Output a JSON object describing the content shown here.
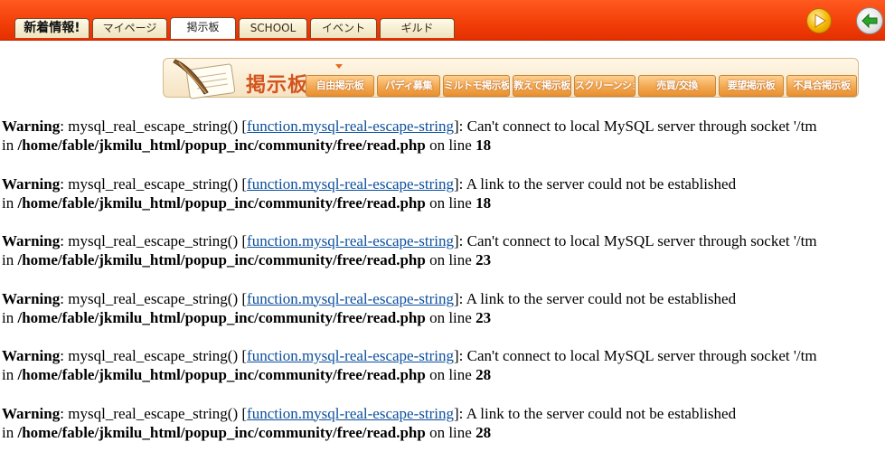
{
  "nav": {
    "tabs": [
      {
        "label": "新着情報!"
      },
      {
        "label": "マイページ"
      },
      {
        "label": "掲示板"
      },
      {
        "label": "SCHOOL"
      },
      {
        "label": "イベント"
      },
      {
        "label": "ギルド"
      }
    ],
    "active_tab": "掲示板"
  },
  "icons": {
    "play": "play-icon",
    "back": "back-arrow-icon",
    "quill": "quill-scroll-icon"
  },
  "board": {
    "title": "掲示板",
    "subtabs": [
      {
        "label": "自由掲示板"
      },
      {
        "label": "パディ募集"
      },
      {
        "label": "ミルトモ掲示板"
      },
      {
        "label": "教えて掲示板"
      },
      {
        "label": "スクリーンショット"
      },
      {
        "label": "売買/交換"
      },
      {
        "label": "要望掲示板"
      },
      {
        "label": "不具合掲示板"
      }
    ]
  },
  "colors": {
    "topbar": "#f23d08",
    "link": "#0b4f9e",
    "subtab": "#f2a852",
    "title": "#d3551e"
  },
  "warnings": [
    {
      "label": "Warning",
      "func": "mysql_real_escape_string()",
      "link": "function.mysql-real-escape-string",
      "message": "Can't connect to local MySQL server through socket '/tm",
      "in": "in",
      "path": "/home/fable/jkmilu_html/popup_inc/community/free/read.php",
      "on_line": "on line",
      "line": "18"
    },
    {
      "label": "Warning",
      "func": "mysql_real_escape_string()",
      "link": "function.mysql-real-escape-string",
      "message": "A link to the server could not be established",
      "in": "in",
      "path": "/home/fable/jkmilu_html/popup_inc/community/free/read.php",
      "on_line": "on line",
      "line": "18"
    },
    {
      "label": "Warning",
      "func": "mysql_real_escape_string()",
      "link": "function.mysql-real-escape-string",
      "message": "Can't connect to local MySQL server through socket '/tm",
      "in": "in",
      "path": "/home/fable/jkmilu_html/popup_inc/community/free/read.php",
      "on_line": "on line",
      "line": "23"
    },
    {
      "label": "Warning",
      "func": "mysql_real_escape_string()",
      "link": "function.mysql-real-escape-string",
      "message": "A link to the server could not be established",
      "in": "in",
      "path": "/home/fable/jkmilu_html/popup_inc/community/free/read.php",
      "on_line": "on line",
      "line": "23"
    },
    {
      "label": "Warning",
      "func": "mysql_real_escape_string()",
      "link": "function.mysql-real-escape-string",
      "message": "Can't connect to local MySQL server through socket '/tm",
      "in": "in",
      "path": "/home/fable/jkmilu_html/popup_inc/community/free/read.php",
      "on_line": "on line",
      "line": "28"
    },
    {
      "label": "Warning",
      "func": "mysql_real_escape_string()",
      "link": "function.mysql-real-escape-string",
      "message": "A link to the server could not be established",
      "in": "in",
      "path": "/home/fable/jkmilu_html/popup_inc/community/free/read.php",
      "on_line": "on line",
      "line": "28"
    }
  ]
}
